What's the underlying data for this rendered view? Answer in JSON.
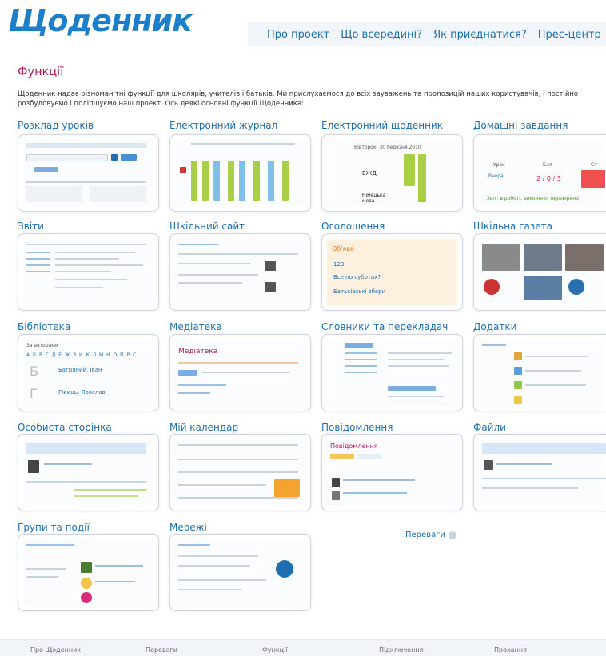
{
  "logo": "Щоденник",
  "nav": [
    "Про проект",
    "Що всередині?",
    "Як приєднатися?",
    "Прес-центр"
  ],
  "title": "Функції",
  "intro": "Щоденник надає різноманітні функції для школярів, учителів і батьків. Ми прислухаємося до всіх зауважень та пропозицій наших користувачів, і постійно розбудовуємо і поліпшуємо наш проект. Ось деякі основні функції Щоденника:",
  "features": [
    "Розклад уроків",
    "Електронний журнал",
    "Електронний щоденник",
    "Домашні завдання",
    "Звіти",
    "Шкільний сайт",
    "Оголошення",
    "Шкільна газета",
    "Бібліотека",
    "Медіатека",
    "Словники та перекладач",
    "Додатки",
    "Особиста сторінка",
    "Мій календар",
    "Повідомлення",
    "Файли",
    "Групи та події",
    "Мережі"
  ],
  "thumbs": {
    "ejournal_date": "Вівторок, 30 березня 2010",
    "ejournal_subject": "БЖД",
    "ejournal_subject2": "Німецька мова",
    "hw_cols": [
      "Урок",
      "Бал",
      "Ст"
    ],
    "hw_row": "Вчора",
    "hw_grade": "2 / 0 / 3",
    "hw_status": "Звіт: в роботі, виконано, перевірено",
    "announce_title": "Об'ява",
    "announce_items": [
      "123",
      "Все по суботах?",
      "Батьківські збори"
    ],
    "library_title": "За авторами",
    "library_alphabet": "А Б В Г Д Е Ж З И К Л М Н О П Р С",
    "library_authors": [
      "Багряний, Іван",
      "Гжиць, Ярослав"
    ],
    "library_letters": [
      "Б",
      "Г"
    ],
    "media_title": "Медіатека",
    "messages_title": "Повідомлення",
    "calendar_title": "Мій календар"
  },
  "skip_label": "Переваги",
  "footer": [
    "Про Щоденник",
    "Переваги",
    "Функції",
    "Підключення",
    "Прохання"
  ],
  "colors": {
    "accent": "#1e6fb1",
    "title": "#b11d57",
    "logo": "#1d7fc9"
  }
}
